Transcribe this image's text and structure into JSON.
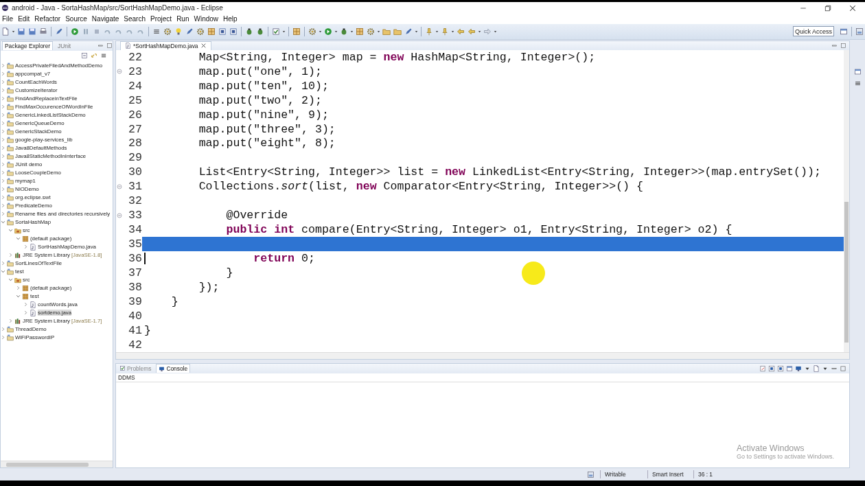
{
  "window": {
    "title": "android - Java - SortaHashMap/src/SortHashMapDemo.java - Eclipse"
  },
  "menu": [
    "File",
    "Edit",
    "Refactor",
    "Source",
    "Navigate",
    "Search",
    "Project",
    "Run",
    "Window",
    "Help"
  ],
  "toolbar": {
    "quick_access": {
      "placeholder": "Quick Access"
    }
  },
  "package_explorer": {
    "tabs": [
      {
        "label": "Package Explorer",
        "selected": true
      },
      {
        "label": "JUnit",
        "selected": false
      }
    ],
    "tree": [
      {
        "label": "AccessPrivateFiledAndMethodDemo",
        "kind": "project",
        "expanded": false,
        "selected": false
      },
      {
        "label": "appcompat_v7",
        "kind": "project",
        "expanded": false,
        "selected": false
      },
      {
        "label": "CountEachWords",
        "kind": "project",
        "expanded": false,
        "selected": false
      },
      {
        "label": "CustomizeIterator",
        "kind": "project",
        "expanded": false,
        "selected": false
      },
      {
        "label": "FindAndReplaceinTextFile",
        "kind": "project",
        "expanded": false,
        "selected": false
      },
      {
        "label": "FindMaxOccurenceOfWordInFile",
        "kind": "project",
        "expanded": false,
        "selected": false
      },
      {
        "label": "GenericLinkedListStackDemo",
        "kind": "project",
        "expanded": false,
        "selected": false
      },
      {
        "label": "GenericQueueDemo",
        "kind": "project",
        "expanded": false,
        "selected": false
      },
      {
        "label": "GenericStackDemo",
        "kind": "project",
        "expanded": false,
        "selected": false
      },
      {
        "label": "google-play-services_lib",
        "kind": "project",
        "expanded": false,
        "selected": false
      },
      {
        "label": "Java8DefaultMethods",
        "kind": "project",
        "expanded": false,
        "selected": false
      },
      {
        "label": "Java8StaticMethodInInterface",
        "kind": "project",
        "expanded": false,
        "selected": false
      },
      {
        "label": "JUnit demo",
        "kind": "project",
        "expanded": false,
        "selected": false
      },
      {
        "label": "LooseCoupleDemo",
        "kind": "project",
        "expanded": false,
        "selected": false
      },
      {
        "label": "mymap1",
        "kind": "project",
        "expanded": false,
        "selected": false
      },
      {
        "label": "NIODemo",
        "kind": "project",
        "expanded": false,
        "selected": false
      },
      {
        "label": "org.eclipse.swt",
        "kind": "project",
        "expanded": false,
        "selected": false
      },
      {
        "label": "PredicateDemo",
        "kind": "project",
        "expanded": false,
        "selected": false
      },
      {
        "label": "Rename files and directories recursively",
        "kind": "project",
        "expanded": false,
        "selected": false
      },
      {
        "label": "SortaHashMap",
        "kind": "project",
        "expanded": true,
        "selected": false,
        "children": [
          {
            "label": "src",
            "kind": "folder",
            "expanded": true,
            "selected": false,
            "children": [
              {
                "label": "(default package)",
                "kind": "package",
                "expanded": true,
                "selected": false,
                "children": [
                  {
                    "label": "SortHashMapDemo.java",
                    "kind": "file",
                    "expanded": false,
                    "selected": false
                  }
                ]
              }
            ]
          },
          {
            "label": "JRE System Library",
            "detail": "[JavaSE-1.8]",
            "kind": "library",
            "expanded": false,
            "selected": false
          }
        ]
      },
      {
        "label": "SortLinesOfTextFile",
        "kind": "project",
        "expanded": false,
        "selected": false
      },
      {
        "label": "test",
        "kind": "project",
        "expanded": true,
        "selected": false,
        "children": [
          {
            "label": "src",
            "kind": "folder",
            "expanded": true,
            "selected": false,
            "children": [
              {
                "label": "(default package)",
                "kind": "package",
                "expanded": false,
                "selected": false
              },
              {
                "label": "test",
                "kind": "package",
                "expanded": true,
                "selected": false,
                "children": [
                  {
                    "label": "countWords.java",
                    "kind": "file",
                    "expanded": false,
                    "selected": false
                  },
                  {
                    "label": "sortdemo.java",
                    "kind": "file",
                    "expanded": false,
                    "selected": true
                  }
                ]
              }
            ]
          },
          {
            "label": "JRE System Library",
            "detail": "[JavaSE-1.7]",
            "kind": "library",
            "expanded": false,
            "selected": false
          }
        ]
      },
      {
        "label": "ThreadDemo",
        "kind": "project",
        "expanded": false,
        "selected": false
      },
      {
        "label": "WiFiPasswordIP",
        "kind": "project",
        "expanded": false,
        "selected": false
      }
    ]
  },
  "editor": {
    "tab": {
      "label": "*SortHashMapDemo.java"
    },
    "lines": [
      {
        "number": "22",
        "code": "        Map<String, Integer> map = **new** HashMap<String, Integer>();",
        "selected": false
      },
      {
        "number": "23",
        "code": "        map.put(\"one\", 1);",
        "selected": false,
        "fold": true
      },
      {
        "number": "24",
        "code": "        map.put(\"ten\", 10);",
        "selected": false
      },
      {
        "number": "25",
        "code": "        map.put(\"two\", 2);",
        "selected": false
      },
      {
        "number": "26",
        "code": "        map.put(\"nine\", 9);",
        "selected": false
      },
      {
        "number": "27",
        "code": "        map.put(\"three\", 3);",
        "selected": false
      },
      {
        "number": "28",
        "code": "        map.put(\"eight\", 8);",
        "selected": false
      },
      {
        "number": "29",
        "selected": false
      },
      {
        "number": "30",
        "code": "        List<Entry<String, Integer>> list = **new** LinkedList<Entry<String, Integer>>(map.entrySet());",
        "selected": false
      },
      {
        "number": "31",
        "code": "        Collections.*sort*(list, **new** Comparator<Entry<String, Integer>>() {",
        "selected": false,
        "fold": true
      },
      {
        "number": "32",
        "selected": false
      },
      {
        "number": "33",
        "code": "            @Override",
        "selected": false,
        "fold": true
      },
      {
        "number": "34",
        "code": "            **public** **int** compare(Entry<String, Integer> o1, Entry<String, Integer> o2) {",
        "selected": false
      },
      {
        "number": "35",
        "selected": true
      },
      {
        "number": "36",
        "code": "                **return** 0;",
        "selected": false,
        "cursor": true
      },
      {
        "number": "37",
        "code": "            }",
        "selected": false
      },
      {
        "number": "38",
        "code": "        });",
        "selected": false
      },
      {
        "number": "39",
        "code": "    }",
        "selected": false
      },
      {
        "number": "40",
        "selected": false
      },
      {
        "number": "41",
        "code": "}",
        "selected": false
      },
      {
        "number": "42",
        "selected": false
      }
    ]
  },
  "console": {
    "tabs": [
      {
        "label": "Problems",
        "selected": false
      },
      {
        "label": "Console",
        "selected": true
      }
    ],
    "title": "DDMS",
    "watermark": {
      "heading": "Activate Windows",
      "text": "Go to Settings to activate Windows."
    }
  },
  "status_bar": {
    "mode": "Writable",
    "insert": "Smart Insert",
    "position": "36 : 1"
  }
}
